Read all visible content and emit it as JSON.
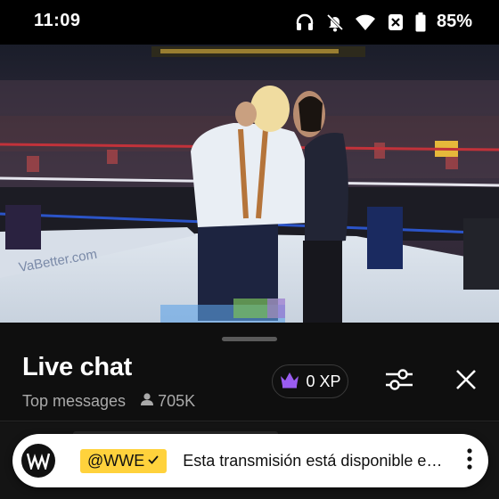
{
  "status_bar": {
    "time": "11:09",
    "battery_percent": "85%",
    "icons": [
      "headphones-icon",
      "bell-off-icon",
      "wifi-icon",
      "data-saver-icon",
      "battery-icon"
    ]
  },
  "video": {
    "description_icon": "video-frame",
    "sponsor_text": "VaBetter.com"
  },
  "chat": {
    "title": "Live chat",
    "mode": "Top messages",
    "viewer_count": "705K",
    "xp_label": "0 XP"
  },
  "pinned": {
    "author": "@WWE",
    "message": "Esta transmisión está disponible e…",
    "colors": {
      "author_bg": "#ffd23c",
      "banner_bg": "#ffffff"
    }
  }
}
